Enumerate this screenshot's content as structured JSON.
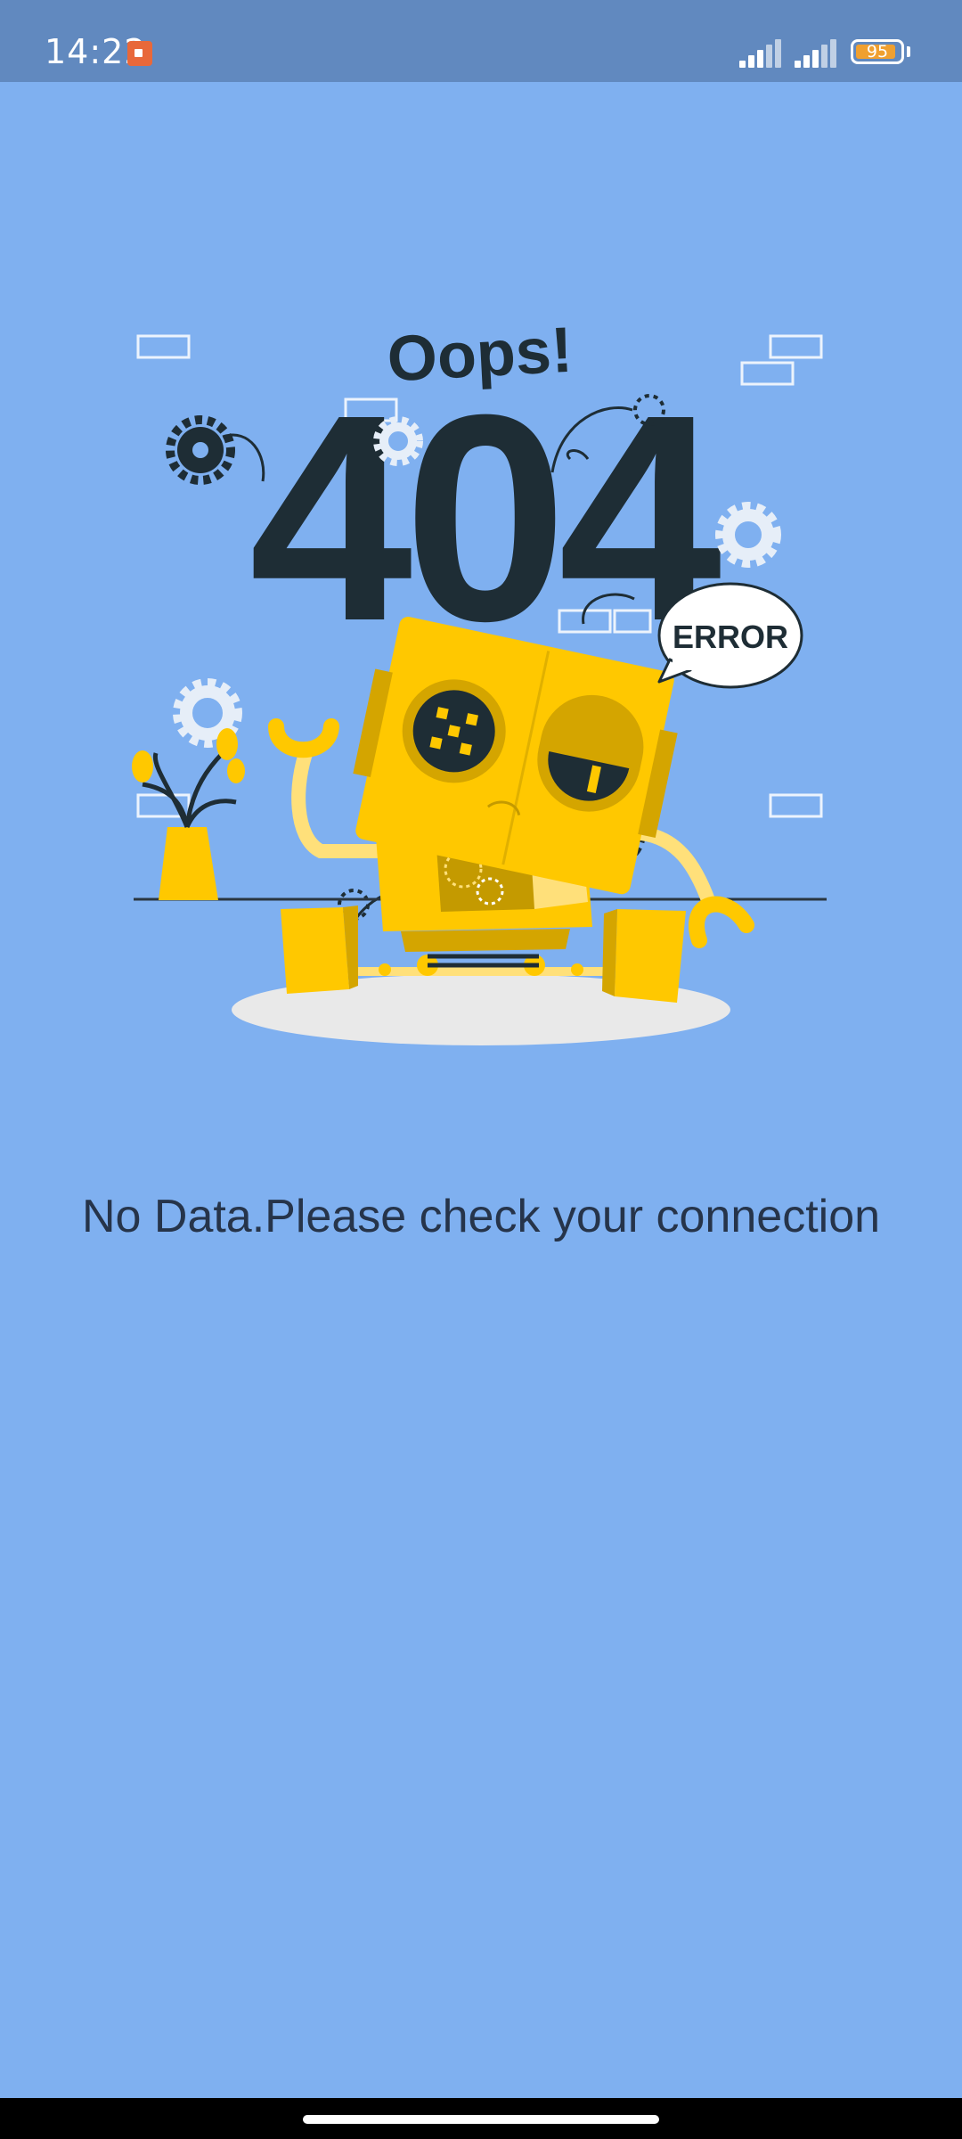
{
  "status_bar": {
    "time": "14:22",
    "battery": "95",
    "icons": [
      "screen-record-icon",
      "signal-icon",
      "signal-icon",
      "battery-icon"
    ]
  },
  "illustration": {
    "oops": "Oops!",
    "code": "404",
    "bubble": "ERROR"
  },
  "message": "No Data.Please check your connection",
  "colors": {
    "background": "#7fb0f0",
    "status_bar": "#6189bf",
    "robot_yellow": "#ffc800",
    "dark": "#1e2d35",
    "message_text": "#26344a"
  }
}
